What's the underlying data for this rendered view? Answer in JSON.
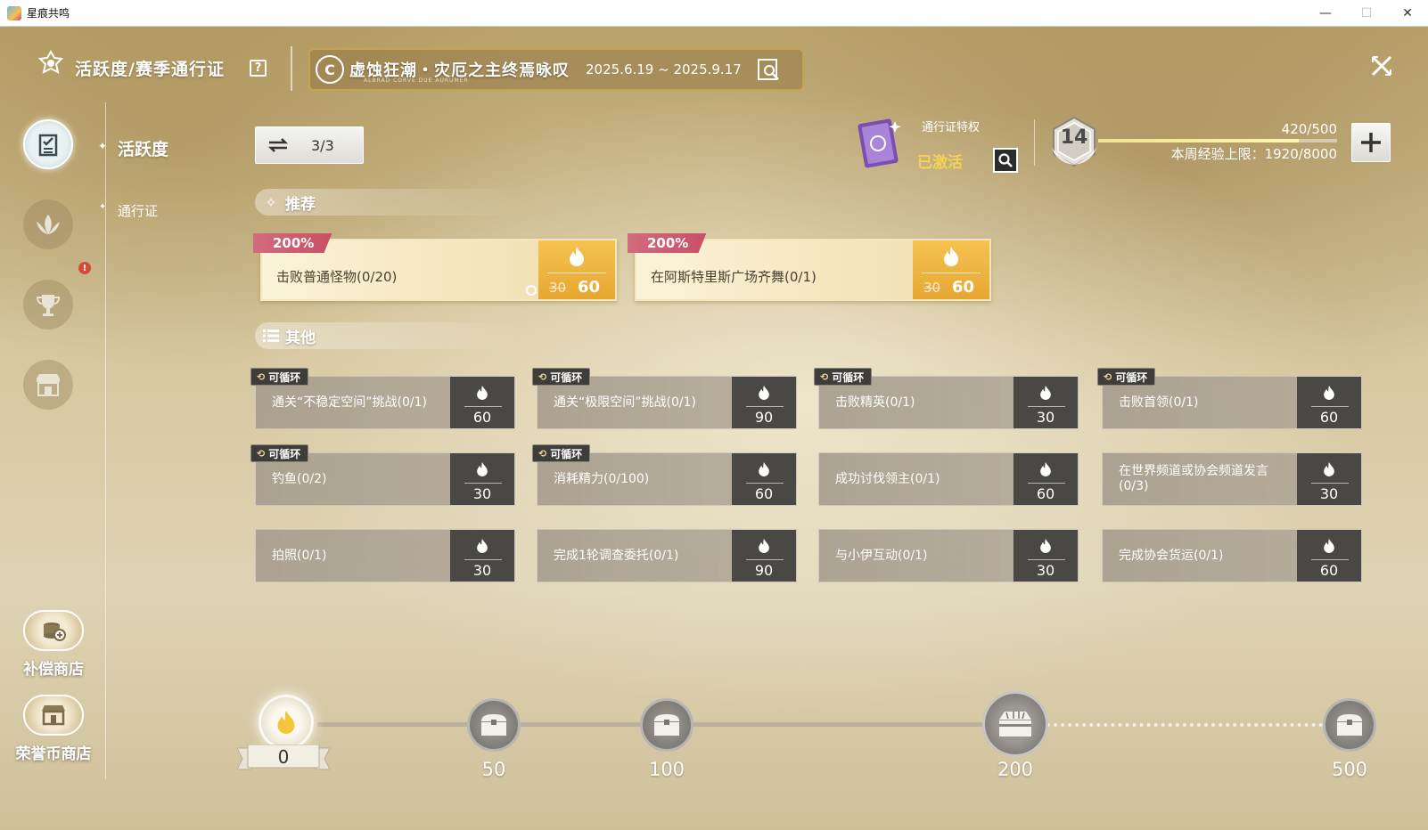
{
  "window": {
    "title": "星痕共鸣",
    "minimize": "—",
    "maximize": "☐",
    "close": "✕"
  },
  "header": {
    "title": "活跃度/赛季通行证",
    "help": "?",
    "season_logo": "C",
    "season_name": "虚蚀狂潮・灾厄之主终焉咏叹",
    "season_sub": "ALBRAD CORVE DUE AURUMER",
    "season_dates": "2025.6.19 ~ 2025.9.17"
  },
  "sidebar": {
    "items": [
      {
        "label": "活跃度",
        "active": true
      },
      {
        "label": "通行证",
        "active": false
      }
    ],
    "alert": "!",
    "shops": [
      {
        "label": "补偿商店"
      },
      {
        "label": "荣誉币商店"
      }
    ]
  },
  "topbar": {
    "refresh_count": "3/3",
    "pass_title": "通行证特权",
    "pass_status": "已激活",
    "level": "14",
    "exp_value": "420/500",
    "exp_progress": 0.84,
    "weekly_limit": "本周经验上限：1920/8000"
  },
  "recommended": {
    "title": "推荐",
    "cards": [
      {
        "badge": "200%",
        "text": "击败普通怪物(0/20)",
        "old": "30",
        "new": "60"
      },
      {
        "badge": "200%",
        "text": "在阿斯特里斯广场齐舞(0/1)",
        "old": "30",
        "new": "60"
      }
    ]
  },
  "other": {
    "title": "其他",
    "cycle_label": "可循环",
    "tasks": [
      {
        "text": "通关“不稳定空间”挑战(0/1)",
        "value": "60",
        "cycle": true
      },
      {
        "text": "通关“极限空间”挑战(0/1)",
        "value": "90",
        "cycle": true
      },
      {
        "text": "击败精英(0/1)",
        "value": "30",
        "cycle": true
      },
      {
        "text": "击败首领(0/1)",
        "value": "60",
        "cycle": true
      },
      {
        "text": "钓鱼(0/2)",
        "value": "30",
        "cycle": true
      },
      {
        "text": "消耗精力(0/100)",
        "value": "60",
        "cycle": true
      },
      {
        "text": "成功讨伐领主(0/1)",
        "value": "60",
        "cycle": false
      },
      {
        "text": "在世界频道或协会频道发言(0/3)",
        "value": "30",
        "cycle": false
      },
      {
        "text": "拍照(0/1)",
        "value": "30",
        "cycle": false
      },
      {
        "text": "完成1轮调查委托(0/1)",
        "value": "90",
        "cycle": false
      },
      {
        "text": "与小伊互动(0/1)",
        "value": "30",
        "cycle": false
      },
      {
        "text": "完成协会货运(0/1)",
        "value": "60",
        "cycle": false
      }
    ]
  },
  "progress": {
    "current": "0",
    "milestones": [
      "50",
      "100",
      "200",
      "500"
    ]
  },
  "colors": {
    "badge": "#c85065",
    "reward_gold": "#e6a732",
    "pass_active": "#f4d356",
    "task_reward_bg": "#4a4845"
  }
}
